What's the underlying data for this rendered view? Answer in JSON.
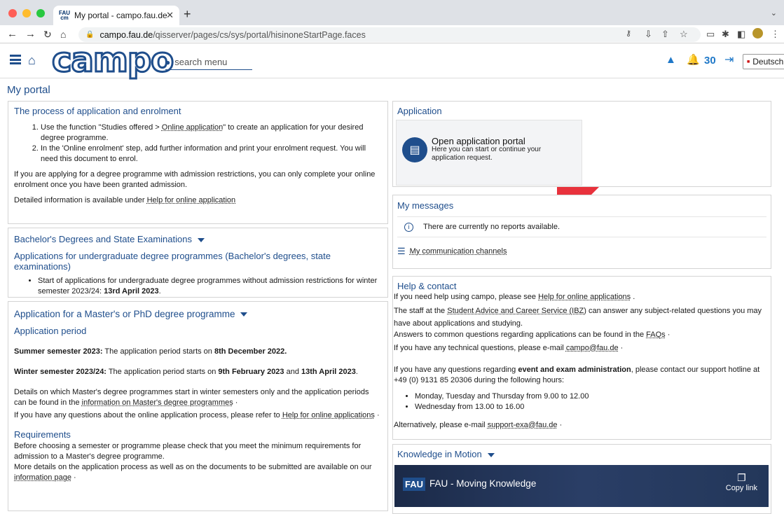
{
  "browser": {
    "tab_title": "My portal - campo.fau.de",
    "favicon_text": "FAU cm",
    "url_host": "campo.fau.de",
    "url_path": "/qisserver/pages/cs/sys/portal/hisinoneStartPage.faces"
  },
  "header": {
    "logo": "campo",
    "search_placeholder": "search menu",
    "notification_count": "30",
    "language": "Deutsch"
  },
  "page_title": "My portal",
  "process": {
    "title": "The process of application and enrolment",
    "step1_a": "Use the function \"Studies offered > ",
    "step1_link": "Online application",
    "step1_b": "\" to create an application for your desired degree programme.",
    "step2": "In the 'Online enrolment' step, add further information and print your enrolment request. You will need this document to enrol.",
    "para": "If you are applying for a degree programme with admission restrictions, you can only complete your online enrolment once you have been granted admission.",
    "detail_pre": "Detailed information is available under ",
    "detail_link": "Help for online application"
  },
  "bachelor": {
    "title": "Bachelor's Degrees and State Examinations",
    "subtitle": "Applications for undergraduate degree programmes (Bachelor's degrees, state examinations)",
    "item_pre": "Start of applications for undergraduate degree programmes without admission restrictions for winter semester 2023/24: ",
    "item_bold": "13rd April 2023",
    "item_post": "."
  },
  "master": {
    "title": "Application for a Master's or PhD degree programme",
    "period_title": "Application period",
    "summer_label": "Summer semester 2023:",
    "summer_text": " The application period starts on ",
    "summer_date": "8th December 2022.",
    "winter_label": "Winter semester 2023/24:",
    "winter_text": " The application period starts on ",
    "winter_date1": "9th February 2023",
    "winter_and": " and ",
    "winter_date2": "13th April 2023",
    "winter_end": ".",
    "details_pre": "Details on which Master's degree programmes start in winter semesters only and the application periods can be found in the ",
    "details_link": "information on Master's degree programmes",
    "details_post": " ·",
    "questions_pre": "If you have any questions about the online application process, please refer to ",
    "questions_link": "Help for online applications",
    "questions_post": " ·",
    "req_title": "Requirements",
    "req_p1": "Before choosing a semester or programme please check that you meet the minimum requirements for admission to a Master's degree programme.",
    "req_p2": "More details on the application process as well as on the documents to be submitted are available on our ",
    "req_link": "information page",
    "req_post": " ·"
  },
  "application": {
    "title": "Application",
    "tile_title": "Open application portal",
    "tile_desc": "Here you can start or continue your application request."
  },
  "messages": {
    "title": "My messages",
    "info": "There are currently no reports available.",
    "channels": "My communication channels"
  },
  "help": {
    "title": "Help & contact",
    "l1_pre": "If you need help using campo, please see ",
    "l1_link": "Help for online applications",
    "l1_post": " .",
    "l2_pre": "The staff at the ",
    "l2_link": "Student Advice and Career Service (IBZ)",
    "l2_post": " can answer any subject-related questions you may have about applications and studying.",
    "l3_pre": "Answers to common questions regarding applications can be found in the ",
    "l3_link": "FAQs",
    "l3_post": " ·",
    "l4_pre": "If you have any technical questions, please e-mail ",
    "l4_link": "campo@fau.de",
    "l4_post": " ·",
    "l5_pre": "If you have any questions regarding ",
    "l5_bold": "event and exam administration",
    "l5_post": ", please contact our support hotline at +49 (0) 9131 85 20306 during the following hours:",
    "hours1": "Monday, Tuesday and Thursday from 9.00 to 12.00",
    "hours2": "Wednesday from 13.00 to 16.00",
    "alt_pre": "Alternatively, please e-mail ",
    "alt_link": "support-exa@fau.de",
    "alt_post": " ·"
  },
  "knowledge": {
    "title": "Knowledge in Motion",
    "video_logo": "FAU",
    "video_title": "FAU - Moving Knowledge",
    "copy_link": "Copy link"
  },
  "colors": {
    "accent": "#1f4e8c",
    "arrow": "#e8323c"
  }
}
